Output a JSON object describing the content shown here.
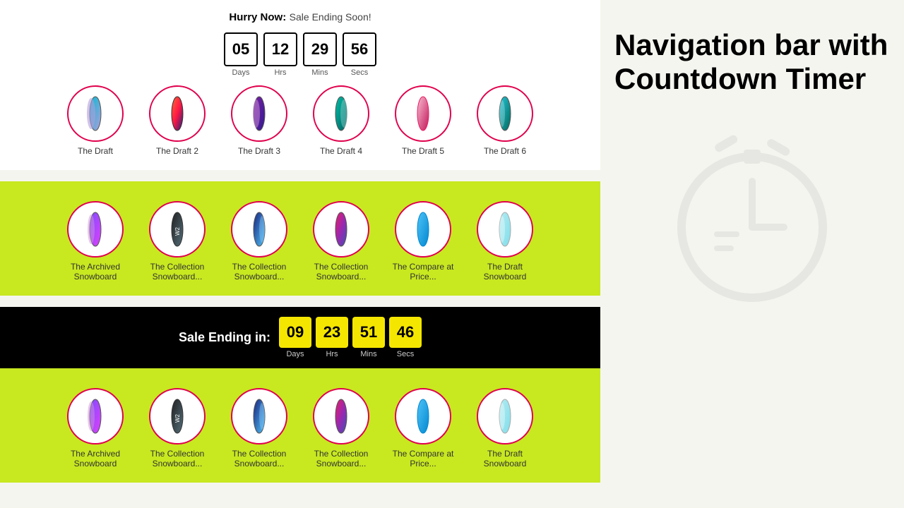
{
  "section1": {
    "hurry_label": "Hurry Now:",
    "sale_ending_label": "Sale Ending Soon!",
    "timer": {
      "days": "05",
      "hrs": "12",
      "mins": "29",
      "secs": "56",
      "days_label": "Days",
      "hrs_label": "Hrs",
      "mins_label": "Mins",
      "secs_label": "Secs"
    },
    "products": [
      {
        "name": "The Draft"
      },
      {
        "name": "The Draft 2"
      },
      {
        "name": "The Draft 3"
      },
      {
        "name": "The Draft 4"
      },
      {
        "name": "The Draft 5"
      },
      {
        "name": "The Draft 6"
      }
    ]
  },
  "section2": {
    "products": [
      {
        "name": "The Archived\nSnowboard"
      },
      {
        "name": "The Collection\nSnowboard..."
      },
      {
        "name": "The Collection\nSnowboard..."
      },
      {
        "name": "The Collection\nSnowboard..."
      },
      {
        "name": "The Compare\nat Price..."
      },
      {
        "name": "The Draft\nSnowboard"
      }
    ]
  },
  "section3": {
    "sale_label": "Sale Ending in:",
    "timer": {
      "days": "09",
      "hrs": "23",
      "mins": "51",
      "secs": "46",
      "days_label": "Days",
      "hrs_label": "Hrs",
      "mins_label": "Mins",
      "secs_label": "Secs"
    },
    "products": [
      {
        "name": "The Archived\nSnowboard"
      },
      {
        "name": "The Collection\nSnowboard..."
      },
      {
        "name": "The Collection\nSnowboard..."
      },
      {
        "name": "The Collection\nSnowboard..."
      },
      {
        "name": "The Compare\nat Price..."
      },
      {
        "name": "The Draft\nSnowboard"
      }
    ]
  },
  "right_panel": {
    "title": "Navigation bar with Countdown Timer"
  }
}
